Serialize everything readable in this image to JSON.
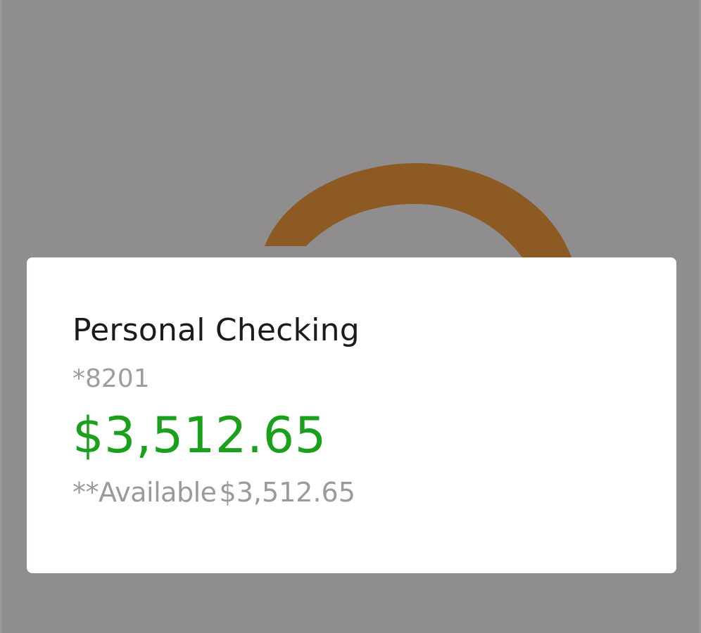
{
  "account": {
    "name": "Personal Checking",
    "number": "*8201",
    "balance": "$3,512.65",
    "available_label": "**Available",
    "available_amount": "$3,512.65"
  },
  "colors": {
    "overlay": "#8f8d8e",
    "spinner": "#8c5a22",
    "card": "#ffffff",
    "balance": "#1aa01a",
    "secondary_text": "#9e9e9e"
  },
  "icons": {
    "loading": "loading-spinner-icon"
  }
}
